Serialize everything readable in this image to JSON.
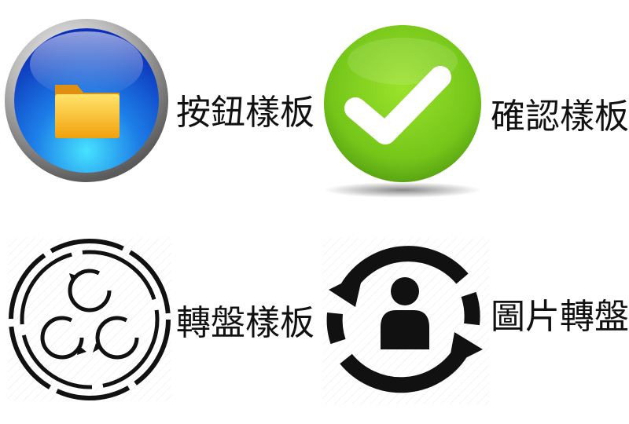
{
  "items": [
    {
      "label": "按鈕樣板",
      "icon": "folder-button-icon",
      "color": "#1f5fd6"
    },
    {
      "label": "確認樣板",
      "icon": "checkmark-icon",
      "color": "#7ccc1c"
    },
    {
      "label": "轉盤樣板",
      "icon": "carousel-cycle-icon",
      "color": "#111111"
    },
    {
      "label": "圖片轉盤",
      "icon": "image-carousel-user-icon",
      "color": "#111111"
    }
  ]
}
